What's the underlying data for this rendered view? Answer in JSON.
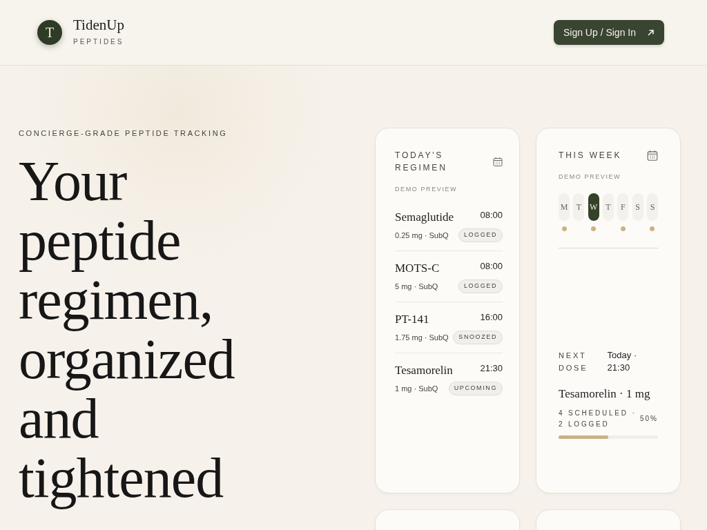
{
  "brand": {
    "initial": "T",
    "name": "TidenUp",
    "tagline": "PEPTIDES"
  },
  "header_button": {
    "label": "Sign Up / Sign In"
  },
  "hero": {
    "eyebrow": "CONCIERGE-GRADE PEPTIDE TRACKING",
    "headline": "Your peptide regimen, organized and tightened"
  },
  "regimen_card": {
    "title": "TODAY'S REGIMEN",
    "subtitle": "DEMO PREVIEW",
    "items": [
      {
        "name": "Semaglutide",
        "time": "08:00",
        "detail": "0.25 mg · SubQ",
        "status": "LOGGED"
      },
      {
        "name": "MOTS-C",
        "time": "08:00",
        "detail": "5 mg · SubQ",
        "status": "LOGGED"
      },
      {
        "name": "PT-141",
        "time": "16:00",
        "detail": "1.75 mg · SubQ",
        "status": "SNOOZED"
      },
      {
        "name": "Tesamorelin",
        "time": "21:30",
        "detail": "1 mg · SubQ",
        "status": "UPCOMING"
      }
    ]
  },
  "week_card": {
    "title": "THIS WEEK",
    "subtitle": "DEMO PREVIEW",
    "days": [
      {
        "label": "M",
        "selected": false,
        "dose": true
      },
      {
        "label": "T",
        "selected": false,
        "dose": false
      },
      {
        "label": "W",
        "selected": true,
        "dose": true
      },
      {
        "label": "T",
        "selected": false,
        "dose": false
      },
      {
        "label": "F",
        "selected": false,
        "dose": true
      },
      {
        "label": "S",
        "selected": false,
        "dose": false
      },
      {
        "label": "S",
        "selected": false,
        "dose": true
      }
    ],
    "next_dose_label": "NEXT DOSE",
    "next_dose_time": "Today · 21:30",
    "next_dose_name": "Tesamorelin · 1 mg",
    "summary": "4 SCHEDULED · 2 LOGGED",
    "percent": "50%",
    "level": 0.5
  }
}
